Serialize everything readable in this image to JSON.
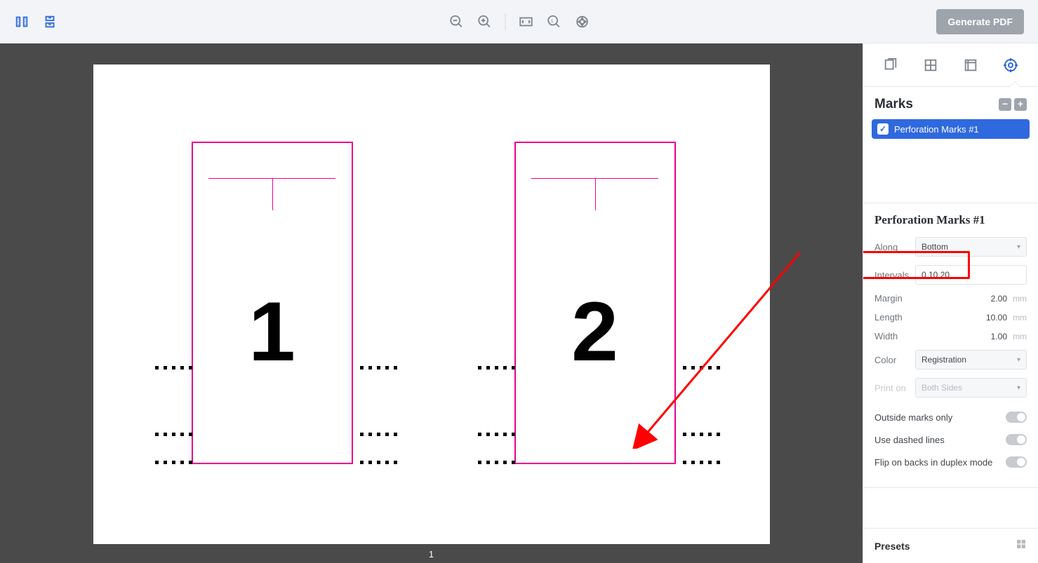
{
  "toolbar": {
    "generate_pdf_label": "Generate PDF"
  },
  "canvas": {
    "page_label": "1",
    "pages": [
      "1",
      "2"
    ]
  },
  "sidebar": {
    "marks_title": "Marks",
    "mark_items": [
      {
        "label": "Perforation Marks #1",
        "checked": true
      }
    ],
    "panel_title": "Perforation Marks #1",
    "along": {
      "label": "Along",
      "value": "Bottom"
    },
    "intervals": {
      "label": "Intervals",
      "value": "0 10 20"
    },
    "margin": {
      "label": "Margin",
      "value": "2.00",
      "unit": "mm"
    },
    "length": {
      "label": "Length",
      "value": "10.00",
      "unit": "mm"
    },
    "width": {
      "label": "Width",
      "value": "1.00",
      "unit": "mm"
    },
    "color": {
      "label": "Color",
      "value": "Registration"
    },
    "print_on": {
      "label": "Print on",
      "value": "Both Sides"
    },
    "toggles": {
      "outside": "Outside marks only",
      "dashed": "Use dashed lines",
      "flip": "Flip on backs in duplex mode"
    },
    "presets_label": "Presets"
  }
}
